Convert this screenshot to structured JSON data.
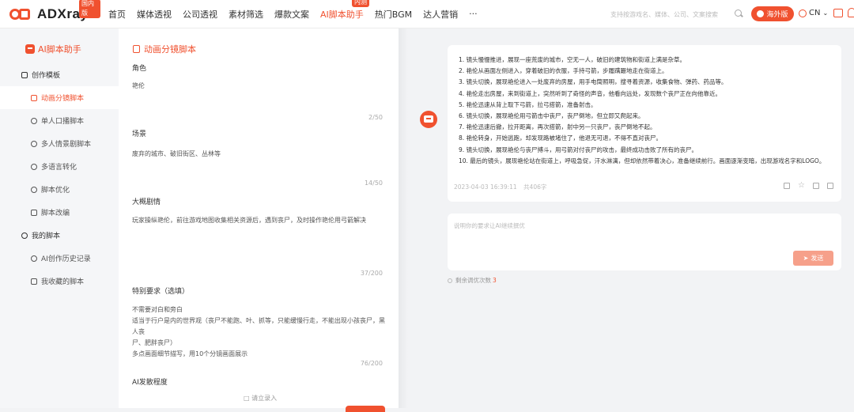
{
  "header": {
    "logo_text": "ADXray",
    "logo_badge": "国内版",
    "nav": [
      {
        "label": "首页"
      },
      {
        "label": "媒体透视"
      },
      {
        "label": "公司透视"
      },
      {
        "label": "素材筛选"
      },
      {
        "label": "爆款文案"
      },
      {
        "label": "AI脚本助手",
        "badge": "内测",
        "active": true
      },
      {
        "label": "热门BGM"
      },
      {
        "label": "达人营销"
      },
      {
        "label": "···"
      }
    ],
    "search_placeholder": "支持按游戏名、媒体、公司、文案搜索",
    "overseas_label": "海外版",
    "language": "CN"
  },
  "sidebar": {
    "title": "AI脚本助手",
    "group1": "创作模板",
    "items": [
      "动画分镜脚本",
      "单人口播脚本",
      "多人情景剧脚本",
      "多语言转化",
      "脚本优化",
      "脚本改编"
    ],
    "active_index": 0,
    "group2": "我的脚本",
    "items2": [
      "AI创作历史记录",
      "我收藏的脚本"
    ]
  },
  "form": {
    "title": "动画分镜脚本",
    "role_label": "角色",
    "role_value": "艳伦",
    "role_count": "2/50",
    "scene_label": "场景",
    "scene_value": "废弃的城市、破旧街区、丛林等",
    "scene_count": "14/50",
    "plot_label": "大概剧情",
    "plot_value": "玩家操纵艳伦，前往游戏地图收集相关资源后，遇到丧尸，及时操作艳伦用弓箭解决",
    "plot_count": "37/200",
    "special_label": "特别要求（选填）",
    "special_lines": [
      "不需要对白和旁白",
      "适当于行户是内的世界观（丧尸不能跑、叶、抓等，只能缓慢行走，不能出现小孩丧尸，黑人丧",
      "尸、肥胖丧尸）",
      "多点画面细节描写，用10个分镜画面展示"
    ],
    "special_count": "76/200",
    "degree_label": "AI发散程度",
    "upload_hint": "请立录入"
  },
  "answer": {
    "lines": [
      "1. 镜头慢慢推进，展现一座荒废的城市，空无一人，破旧的建筑物和街道上满是杂草。",
      "2. 艳伦从画面左侧进入，穿着破旧的衣服，手持弓箭，步履蹒跚地走在街道上。",
      "3. 镜头切换，展现艳伦进入一处废弃的房屋，用手电筒照明，搜寻着资源，收集食物、弹药、药品等。",
      "4. 艳伦走出房屋，来到街道上，突然听到了奇怪的声音，他看向远处，发现数个丧尸正在向他靠近。",
      "5. 艳伦迅速从背上取下弓箭，拉弓搭箭，准备射击。",
      "6. 镜头切换，展现艳伦用弓箭击中丧尸，丧尸倒地，但立即又爬起来。",
      "7. 艳伦迅速后撤，拉开距离，再次搭箭，射中另一只丧尸，丧尸倒地不起。",
      "8. 艳伦转身，开始逃跑，却发现路被堵住了，他退无可退，不得不直对丧尸。",
      "9. 镜头切换，展现艳伦与丧尸搏斗，用弓箭对付丧尸的攻击，最终成功击败了所有的丧尸。",
      "10. 最后的镜头，展现艳伦站在街道上，呼吸急促，汗水淋漓，但却依然带着决心，准备继续前行。画面逐渐变暗，出现游戏名字和LOGO。"
    ],
    "timestamp": "2023-04-03 16:39:11",
    "word_count": "共406字"
  },
  "composer": {
    "placeholder": "说明你的要求让AI继续撰优",
    "send_label": "发送",
    "remaining_label": "剩余调优次数",
    "remaining_count": "3"
  },
  "colors": {
    "accent": "#f0512f",
    "send_disabled": "#f6a08a"
  }
}
